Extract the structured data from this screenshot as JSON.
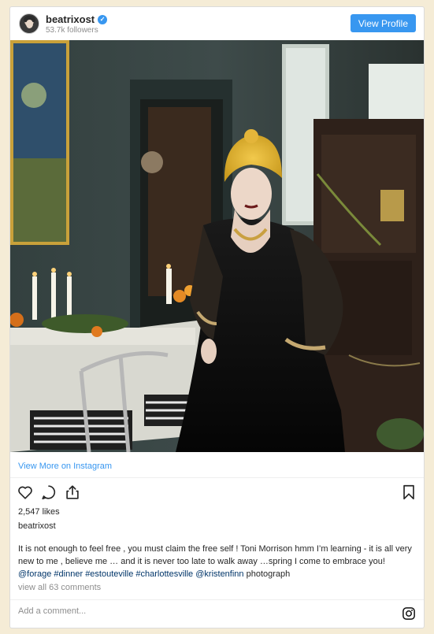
{
  "header": {
    "username": "beatrixost",
    "followers": "53.7k followers",
    "view_profile_label": "View Profile"
  },
  "post": {
    "view_more_label": "View More on Instagram",
    "likes": "2,547 likes",
    "owner": "beatrixost",
    "caption_text": "It is not enough to feel free , you must claim the free self ! Toni Morrison hmm I’m learning - it is all very new to me , believe me … and it is never too late to walk away …spring I come to embrace you!",
    "caption_tags": [
      "@forage",
      "#dinner",
      "#estouteville",
      "#charlottesville",
      "@kristenfinn"
    ],
    "caption_suffix": "photograph",
    "comments_link": "view all 63 comments",
    "comment_placeholder": "Add a comment..."
  },
  "icons": [
    "heart-icon",
    "comment-icon",
    "share-icon",
    "bookmark-icon",
    "instagram-icon",
    "verified-icon"
  ],
  "colors": {
    "accent": "#3897f0",
    "hashtag": "#003569",
    "background": "#f5ecd6"
  }
}
